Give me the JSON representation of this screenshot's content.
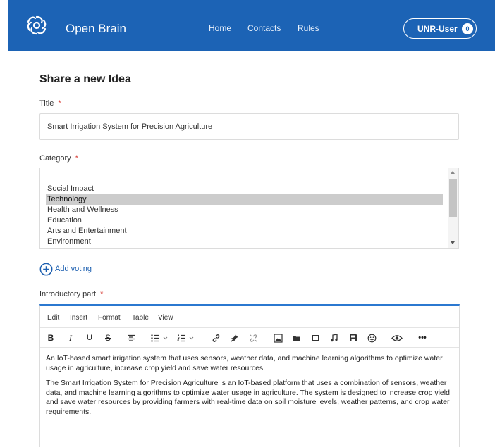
{
  "app": {
    "brand": "Open Brain",
    "nav": [
      {
        "label": "Home"
      },
      {
        "label": "Contacts"
      },
      {
        "label": "Rules"
      }
    ],
    "user": {
      "name": "UNR-User",
      "badge": "0"
    }
  },
  "form": {
    "heading": "Share a new Idea",
    "required_mark": "*",
    "title": {
      "label": "Title",
      "value": "Smart Irrigation System for Precision Agriculture"
    },
    "category": {
      "label": "Category",
      "options": [
        {
          "label": "Social Impact",
          "selected": false
        },
        {
          "label": "Technology",
          "selected": true
        },
        {
          "label": "Health and Wellness",
          "selected": false
        },
        {
          "label": "Education",
          "selected": false
        },
        {
          "label": "Arts and Entertainment",
          "selected": false
        },
        {
          "label": "Environment",
          "selected": false
        }
      ]
    },
    "add_voting": "Add voting",
    "intro": {
      "label": "Introductory part",
      "menu": [
        "Edit",
        "Insert",
        "Format",
        "Table",
        "View"
      ],
      "toolbar_icons": [
        "bold-icon",
        "italic-icon",
        "underline-icon",
        "strikethrough-icon",
        "align-icon",
        "bullet-list-icon",
        "numbered-list-icon",
        "link-icon",
        "pin-icon",
        "unlink-icon",
        "image-icon",
        "folder-icon",
        "media-icon",
        "music-icon",
        "save-icon",
        "emoji-icon",
        "preview-icon",
        "more-icon"
      ],
      "paragraphs": [
        "An IoT-based smart irrigation system that uses sensors, weather data, and machine learning algorithms to optimize water usage in agriculture, increase crop yield and save water resources.",
        "The Smart Irrigation System for Precision Agriculture is an IoT-based platform that uses a combination of sensors, weather data, and machine learning algorithms to optimize water usage in agriculture. The system is designed to increase crop yield and save water resources by providing farmers with real-time data on soil moisture levels, weather patterns, and crop water requirements."
      ]
    }
  },
  "colors": {
    "header_bg": "#1c63b5",
    "accent": "#2b78d0",
    "required": "#d9463f",
    "link": "#1c5fb0",
    "selected_bg": "#cccccc"
  }
}
